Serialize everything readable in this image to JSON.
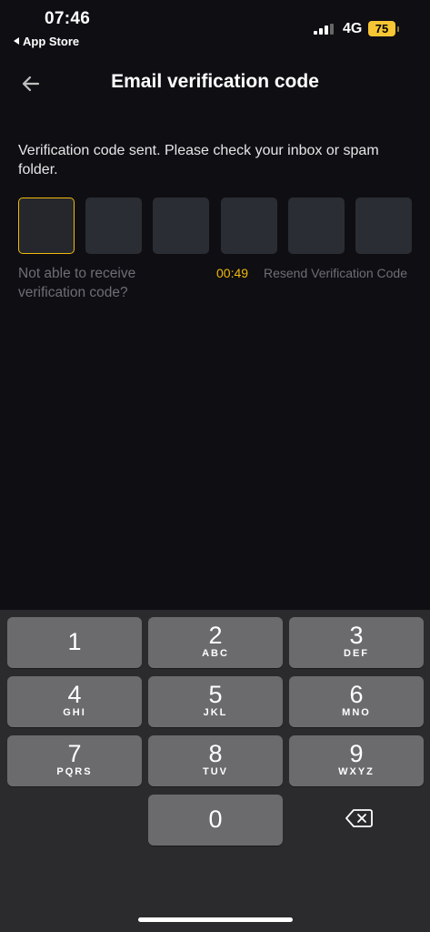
{
  "status_bar": {
    "time": "07:46",
    "back_label": "App Store",
    "network": "4G",
    "battery": "75"
  },
  "header": {
    "title": "Email verification code",
    "back_icon": "arrow-left-icon"
  },
  "instruction": "Verification code sent. Please check your inbox or spam folder.",
  "code_inputs": {
    "count": 6,
    "active_index": 0,
    "values": [
      "",
      "",
      "",
      "",
      "",
      ""
    ]
  },
  "help": {
    "not_able": "Not able to receive verification code?",
    "countdown": "00:49",
    "resend": "Resend Verification Code"
  },
  "keyboard": {
    "keys": [
      {
        "digit": "1",
        "letters": ""
      },
      {
        "digit": "2",
        "letters": "ABC"
      },
      {
        "digit": "3",
        "letters": "DEF"
      },
      {
        "digit": "4",
        "letters": "GHI"
      },
      {
        "digit": "5",
        "letters": "JKL"
      },
      {
        "digit": "6",
        "letters": "MNO"
      },
      {
        "digit": "7",
        "letters": "PQRS"
      },
      {
        "digit": "8",
        "letters": "TUV"
      },
      {
        "digit": "9",
        "letters": "WXYZ"
      },
      {
        "digit": "0",
        "letters": ""
      }
    ],
    "delete_icon": "backspace-icon"
  },
  "colors": {
    "background": "#0f0e13",
    "accent": "#f0b90b",
    "code_box": "#2a2d33",
    "muted_text": "#6c6f76",
    "keyboard_bg": "#2b2b2d",
    "key_bg": "#6b6b6d"
  }
}
